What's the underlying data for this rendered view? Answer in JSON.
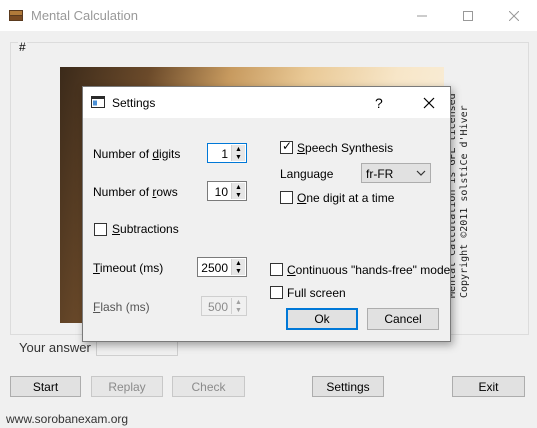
{
  "window": {
    "title": "Mental Calculation",
    "controls": {
      "minimize": "minimize-icon",
      "maximize": "maximize-icon",
      "close": "close-icon"
    }
  },
  "main": {
    "group_label": "#",
    "copyright_lines": [
      "Mental Calculation is GPL licensed",
      "Copyright ©2011 solstiCe d'Hiver"
    ],
    "answer_label": "Your answer",
    "answer_value": "",
    "buttons": {
      "start": "Start",
      "replay": "Replay",
      "check": "Check",
      "settings": "Settings",
      "exit": "Exit"
    },
    "website": "www.sorobanexam.org"
  },
  "settings_dialog": {
    "title": "Settings",
    "help": "?",
    "number_of_digits": {
      "label_pre": "Number of ",
      "label_ul": "d",
      "label_post": "igits",
      "value": "1"
    },
    "number_of_rows": {
      "label_pre": "Number of ",
      "label_ul": "r",
      "label_post": "ows",
      "value": "10"
    },
    "subtractions": {
      "label_pre": "",
      "label_ul": "S",
      "label_post": "ubtractions",
      "checked": false
    },
    "timeout": {
      "label_pre": "",
      "label_ul": "T",
      "label_post": "imeout (ms)",
      "value": "2500"
    },
    "flash": {
      "label_pre": "",
      "label_ul": "F",
      "label_post": "lash (ms)",
      "value": "500"
    },
    "speech_synthesis": {
      "label_pre": "",
      "label_ul": "S",
      "label_post": "peech Synthesis",
      "checked": true
    },
    "language": {
      "label": "Language",
      "value": "fr-FR"
    },
    "one_digit_at_a_time": {
      "label_pre": "",
      "label_ul": "O",
      "label_post": "ne digit at a time",
      "checked": false
    },
    "continuous": {
      "label_pre": "",
      "label_ul": "C",
      "label_post": "ontinuous \"hands-free\" mode",
      "checked": false
    },
    "full_screen": {
      "label": "Full screen",
      "checked": false
    },
    "ok": "Ok",
    "cancel": "Cancel"
  }
}
